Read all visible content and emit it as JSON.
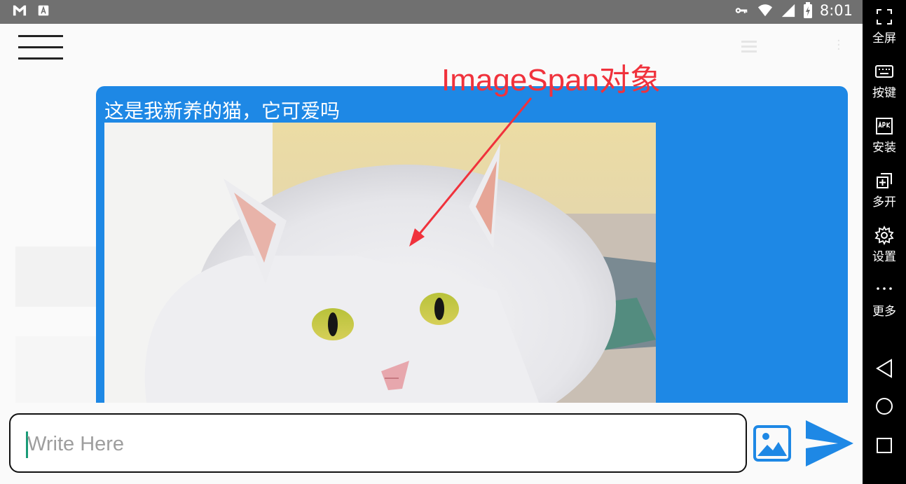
{
  "status_bar": {
    "time": "8:01",
    "left_icons": [
      "gmail-icon",
      "a-badge-icon"
    ],
    "right_icons": [
      "key-icon",
      "wifi-icon",
      "signal-icon",
      "battery-charging-icon"
    ]
  },
  "annotation": {
    "label": "ImageSpan对象",
    "color": "#f0323c"
  },
  "message": {
    "text": "这是我新养的猫，它可爱吗",
    "bubble_color": "#1e88e5",
    "image": "white-cat-photo"
  },
  "composer": {
    "placeholder": "Write Here",
    "image_icon": "image-icon",
    "send_icon": "send-icon",
    "accent": "#1e88e5"
  },
  "sidebar": {
    "items": [
      {
        "label": "全屏",
        "icon": "fullscreen-icon"
      },
      {
        "label": "按键",
        "icon": "keyboard-icon"
      },
      {
        "label": "安装",
        "icon": "apk-icon"
      },
      {
        "label": "多开",
        "icon": "multi-window-icon"
      },
      {
        "label": "设置",
        "icon": "gear-icon"
      },
      {
        "label": "更多",
        "icon": "more-dots-icon"
      }
    ],
    "nav": [
      "back-icon",
      "home-icon",
      "recents-icon"
    ]
  }
}
